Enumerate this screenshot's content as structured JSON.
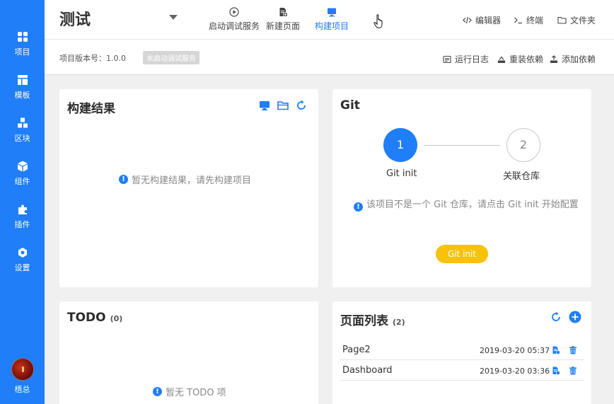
{
  "sidebar": {
    "items": [
      {
        "label": "项目",
        "icon": "grid-icon"
      },
      {
        "label": "模板",
        "icon": "layout-icon"
      },
      {
        "label": "区块",
        "icon": "blocks-icon"
      },
      {
        "label": "组件",
        "icon": "cube-icon"
      },
      {
        "label": "插件",
        "icon": "puzzle-icon"
      },
      {
        "label": "设置",
        "icon": "gear-icon"
      }
    ],
    "user": {
      "name": "梧总"
    }
  },
  "header": {
    "title": "测试",
    "actions": [
      {
        "label": "启动调试服务",
        "icon": "play-icon"
      },
      {
        "label": "新建页面",
        "icon": "new-page-icon"
      },
      {
        "label": "构建项目",
        "icon": "monitor-icon",
        "active": true
      }
    ],
    "right": [
      {
        "label": "编辑器",
        "icon": "code-icon"
      },
      {
        "label": "终端",
        "icon": "terminal-icon"
      },
      {
        "label": "文件夹",
        "icon": "folder-icon"
      }
    ]
  },
  "subheader": {
    "version": "项目版本号：1.0.0",
    "status_badge": "未启动调试服务",
    "actions": [
      {
        "label": "运行日志",
        "icon": "log-icon"
      },
      {
        "label": "重装依赖",
        "icon": "reinstall-icon"
      },
      {
        "label": "添加依赖",
        "icon": "add-dependency-icon"
      }
    ]
  },
  "build": {
    "title": "构建结果",
    "empty": "暂无构建结果，请先构建项目"
  },
  "git": {
    "title": "Git",
    "steps": [
      {
        "number": "1",
        "label": "Git init"
      },
      {
        "number": "2",
        "label": "关联仓库"
      }
    ],
    "info": "该项目不是一个 Git 仓库，请点击 Git init 开始配置",
    "button": "Git init"
  },
  "todo": {
    "title": "TODO",
    "count": "(0)",
    "empty": "暂无 TODO 项"
  },
  "pages": {
    "title": "页面列表",
    "count": "(2)",
    "rows": [
      {
        "name": "Page2",
        "date": "2019-03-20 05:37"
      },
      {
        "name": "Dashboard",
        "date": "2019-03-20 03:36"
      }
    ]
  },
  "colors": {
    "primary": "#1f7ef8",
    "git_button": "#f8c20b",
    "badge": "#d6d6d6"
  }
}
